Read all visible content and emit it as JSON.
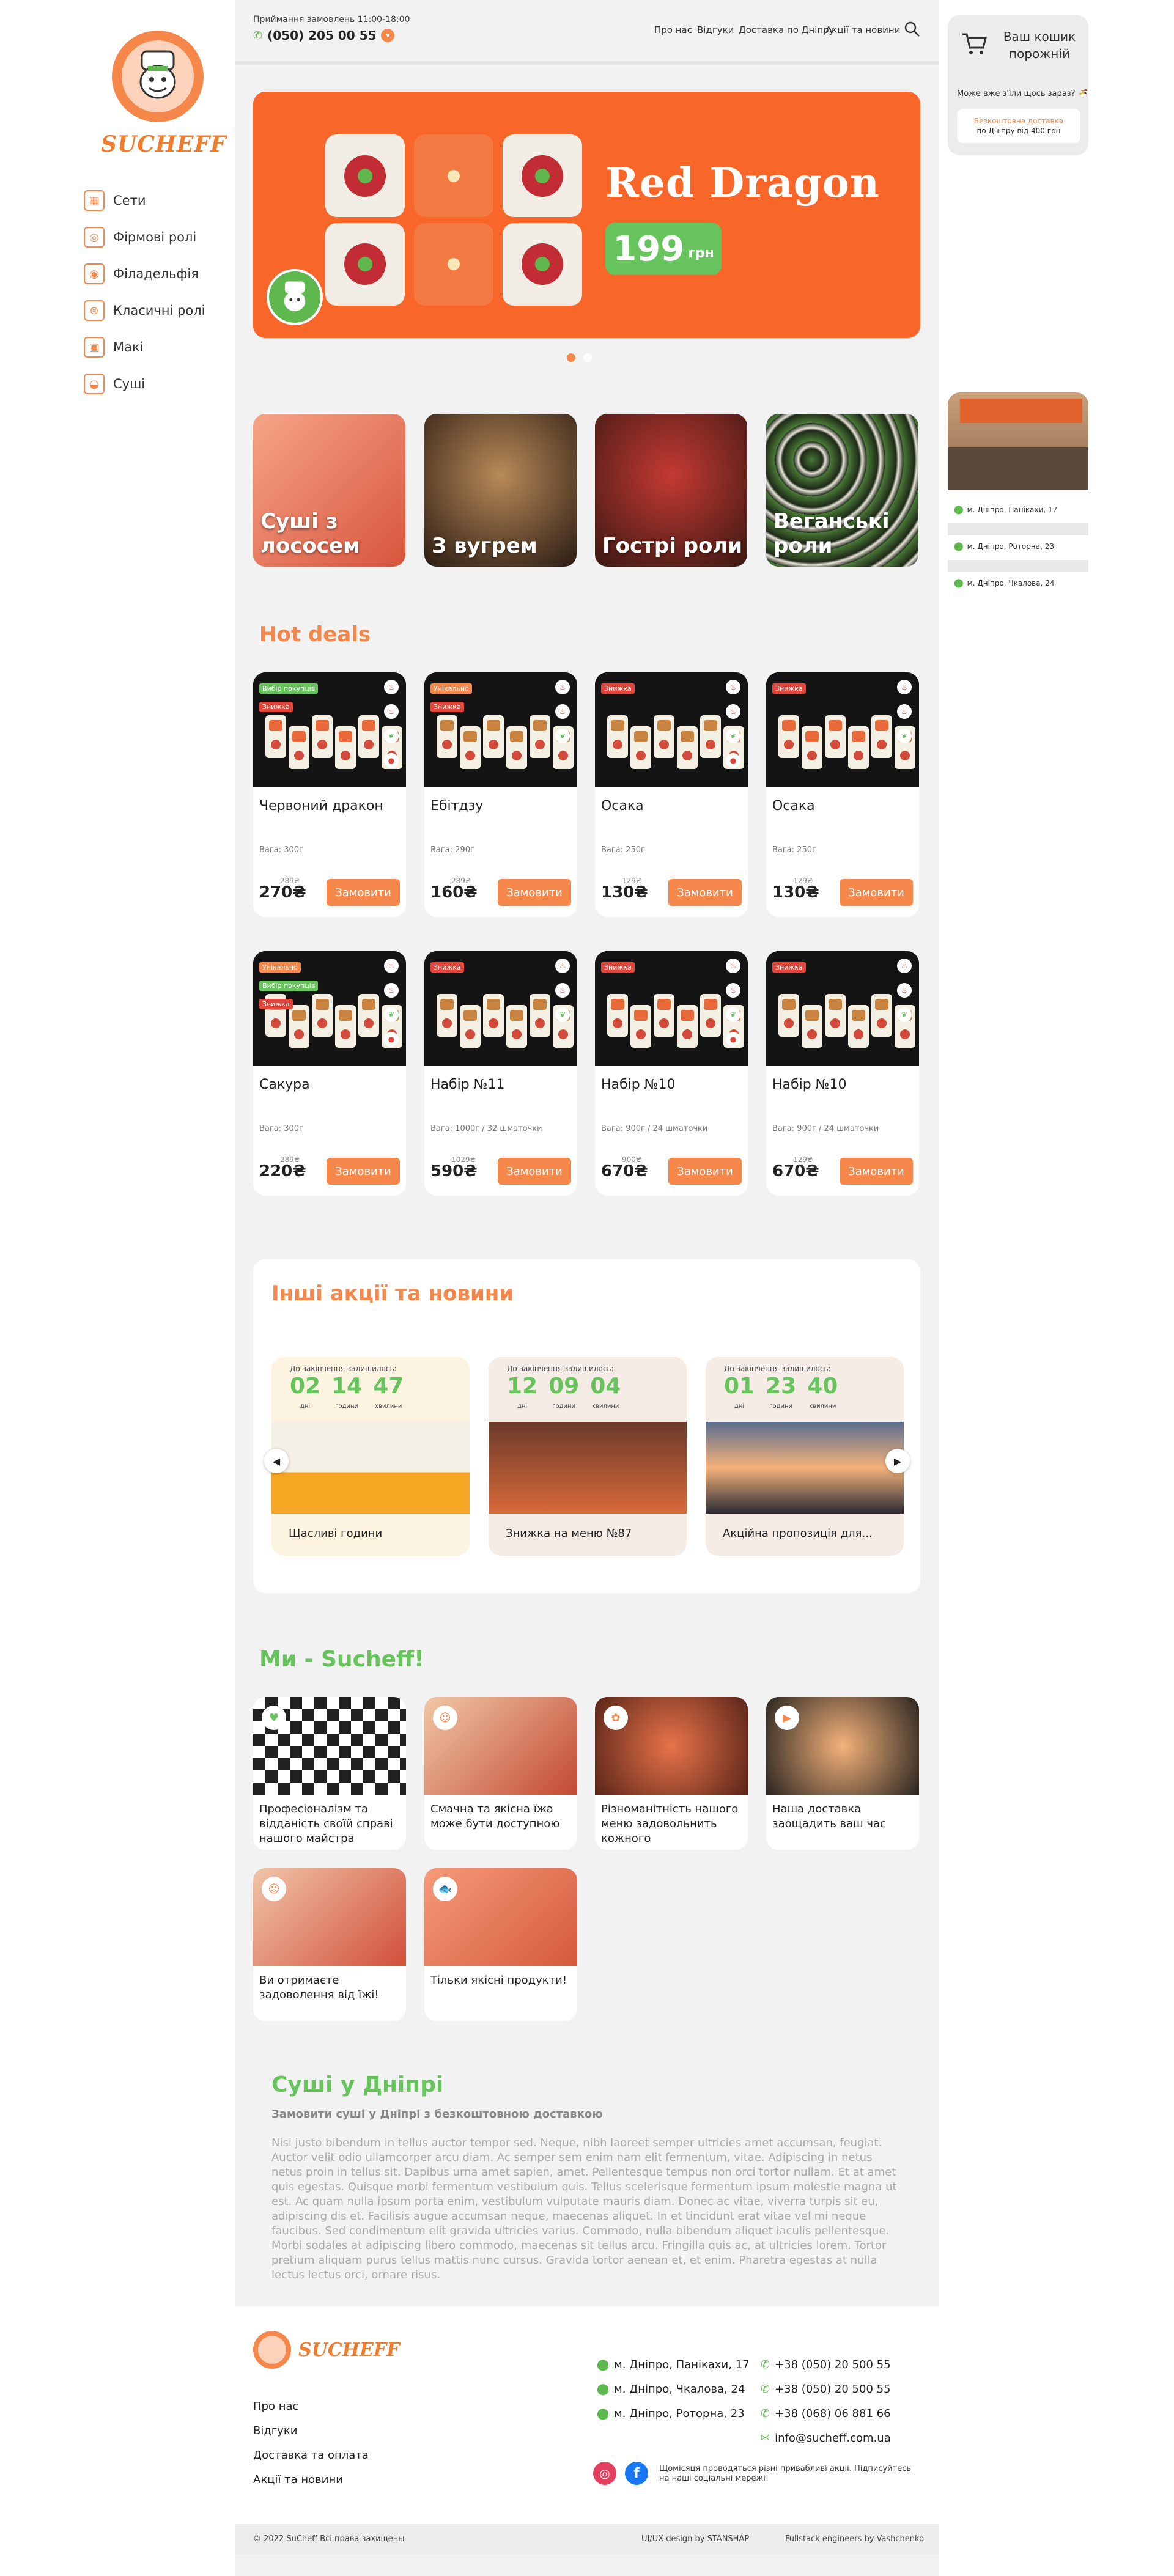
{
  "brand": {
    "logo_text": "SUCHEFF",
    "accent": "#f5874a",
    "green": "#67c35b"
  },
  "categories": [
    {
      "label": "Сети",
      "icon": "grid-icon"
    },
    {
      "label": "Фірмові ролі",
      "icon": "roll-icon"
    },
    {
      "label": "Філадельфія",
      "icon": "philadelphia-icon"
    },
    {
      "label": "Класичні ролі",
      "icon": "classic-roll-icon"
    },
    {
      "label": "Макі",
      "icon": "maki-icon"
    },
    {
      "label": "Суші",
      "icon": "sushi-icon"
    }
  ],
  "header": {
    "hours": "Приймання замовлень 11:00-18:00",
    "phone": "(050) 205 00 55",
    "nav": [
      "Про нас",
      "Відгуки",
      "Доставка по Дніпру",
      "Акції та новини"
    ]
  },
  "banner": {
    "title": "Red Dragon",
    "price": "199",
    "currency": "грн"
  },
  "cart": {
    "title": "Ваш кошик порожній",
    "hint": "Може вже з'їли щось зараз?",
    "shipping_title": "Безкоштовна доставка",
    "shipping_note": "по Дніпру від 400 грн"
  },
  "stores": [
    "м. Дніпро, Панікахи, 17",
    "м. Дніпро, Роторна, 23",
    "м. Дніпро, Чкалова, 24"
  ],
  "tiles": [
    "Суші з лососем",
    "З вугрем",
    "Гострі роли",
    "Веганські роли"
  ],
  "hot_deals": {
    "title": "Hot deals",
    "order_label": "Замовити",
    "products": [
      {
        "name": "Червоний дракон",
        "weight": "Вага: 300г",
        "old_price": "289₴",
        "price": "270₴",
        "badges": [
          "Вибір покупців",
          "Знижка"
        ]
      },
      {
        "name": "Ебітдзу",
        "weight": "Вага: 290г",
        "old_price": "289₴",
        "price": "160₴",
        "badges": [
          "Унікально",
          "Знижка"
        ]
      },
      {
        "name": "Осака",
        "weight": "Вага: 250г",
        "old_price": "129₴",
        "price": "130₴",
        "badges": [
          "Знижка"
        ]
      },
      {
        "name": "Осака",
        "weight": "Вага: 250г",
        "old_price": "129₴",
        "price": "130₴",
        "badges": [
          "Знижка"
        ]
      },
      {
        "name": "Сакура",
        "weight": "Вага: 300г",
        "old_price": "289₴",
        "price": "220₴",
        "badges": [
          "Унікально",
          "Вибір покупців",
          "Знижка"
        ]
      },
      {
        "name": "Набір №11",
        "weight": "Вага: 1000г / 32 шматочки",
        "old_price": "1029₴",
        "price": "590₴",
        "badges": [
          "Знижка"
        ]
      },
      {
        "name": "Набір №10",
        "weight": "Вага: 900г / 24 шматочки",
        "old_price": "900₴",
        "price": "670₴",
        "badges": [
          "Знижка"
        ]
      },
      {
        "name": "Набір №10",
        "weight": "Вага: 900г / 24 шматочки",
        "old_price": "129₴",
        "price": "670₴",
        "badges": [
          "Знижка"
        ]
      }
    ]
  },
  "promotions": {
    "title": "Інші акції та новини",
    "countdown_label": "До закінчення залишилось:",
    "units": [
      "дні",
      "години",
      "хвилини"
    ],
    "cards": [
      {
        "title": "Щасливі години",
        "d": "02",
        "h": "14",
        "m": "47"
      },
      {
        "title": "Знижка на меню №87",
        "d": "12",
        "h": "09",
        "m": "04"
      },
      {
        "title": "Акційна пропозиція для...",
        "d": "01",
        "h": "23",
        "m": "40"
      }
    ]
  },
  "about": {
    "title": "Ми - Sucheff!",
    "items": [
      "Професіоналізм та відданість своїй справі нашого майстра",
      "Смачна та якісна їжа може бути доступною",
      "Різноманітність нашого меню задовольнить кожного",
      "Наша доставка заощадить ваш час",
      "Ви отримаєте задоволення від їжі!",
      "Тільки якісні продукти!"
    ]
  },
  "seo": {
    "title": "Суші у Дніпрі",
    "subtitle": "Замовити суші у Дніпрі з безкоштовною доставкою",
    "body": "Nisi justo bibendum in tellus auctor tempor sed. Neque, nibh laoreet semper ultricies amet accumsan, feugiat. Auctor velit odio ullamcorper arcu diam. Ac semper sem enim nam elit fermentum, vitae. Adipiscing in netus netus proin in tellus sit. Dapibus urna amet sapien, amet. Pellentesque tempus non orci tortor nullam. Et at amet quis egestas. Quisque morbi fermentum vestibulum quis. Tellus scelerisque fermentum ipsum molestie magna ut est. Ac quam nulla ipsum porta enim, vestibulum vulputate mauris diam. Donec ac vitae, viverra turpis sit eu, adipiscing dis et. Facilisis augue accumsan neque, maecenas aliquet. In et tincidunt erat vitae vel mi neque faucibus. Sed condimentum elit gravida ultricies varius. Commodo, nulla bibendum aliquet iaculis pellentesque. Morbi sodales at adipiscing libero commodo, maecenas sit tellus arcu. Fringilla quis ac, at ultricies lorem. Tortor pretium aliquam purus tellus mattis nunc cursus. Gravida tortor aenean et, et enim. Pharetra egestas at nulla lectus lectus orci, ornare risus."
  },
  "footer": {
    "links": [
      "Про нас",
      "Відгуки",
      "Доставка та оплата",
      "Акції та новини"
    ],
    "addresses": [
      "м. Дніпро, Панікахи, 17",
      "м. Дніпро, Чкалова, 24",
      "м. Дніпро, Роторна, 23"
    ],
    "phones": [
      "+38 (050) 20 500 55",
      "+38 (050) 20 500 55",
      "+38 (068) 06 881 66"
    ],
    "email": "info@sucheff.com.ua",
    "social_note": "Щомісяця проводяться різні привабливі акції. Підписуйтесь на наші соціальні мережі!",
    "copyright": "© 2022 SuCheff Всі права захищены",
    "design": "UI/UX design by STANSHAP",
    "dev": "Fullstack engineers by Vashchenko"
  }
}
